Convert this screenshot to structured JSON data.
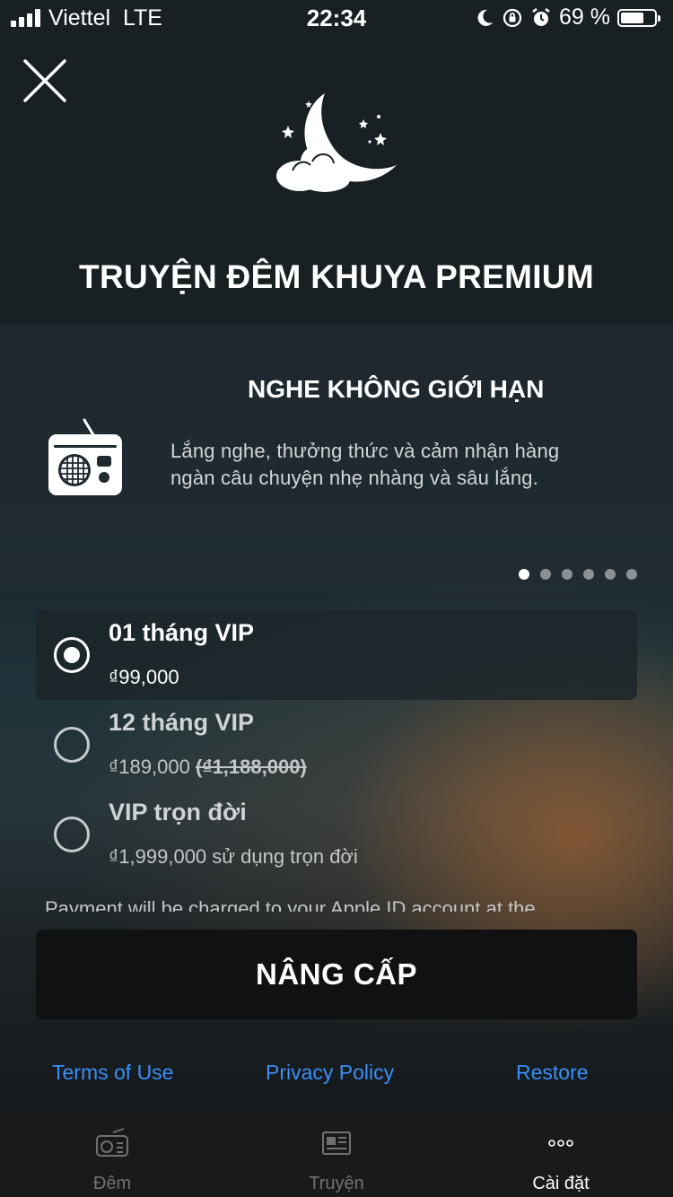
{
  "status_bar": {
    "carrier": "Viettel",
    "network": "LTE",
    "time": "22:34",
    "battery": "69 %",
    "battery_level": 0.69
  },
  "header": {
    "title": "TRUYỆN ĐÊM KHUYA PREMIUM"
  },
  "feature": {
    "title": "NGHE KHÔNG GIỚI HẠN",
    "description_line1": "Lắng nghe, thưởng thức và cảm nhận hàng",
    "description_line2": "ngàn câu chuyện nhẹ nhàng và sâu lắng.",
    "page_count": 6,
    "active_page": 1
  },
  "plans": [
    {
      "name": "01 tháng VIP",
      "price": "₫99,000",
      "original_price": "",
      "selected": true
    },
    {
      "name": "12 tháng VIP",
      "price": "₫189,000",
      "original_price": "(₫1,188,000)",
      "selected": false
    },
    {
      "name": "VIP trọn đời",
      "price": "₫1,999,000 sử dụng trọn đời",
      "original_price": "",
      "selected": false
    }
  ],
  "terms_preview": "Payment will be charged to your Apple ID account at the",
  "upgrade_button": "NÂNG CẤP",
  "links": {
    "terms": "Terms of Use",
    "privacy": "Privacy Policy",
    "restore": "Restore"
  },
  "tabbar": {
    "tabs": [
      {
        "label": "Đêm",
        "icon": "radio-icon",
        "active": false
      },
      {
        "label": "Truyện",
        "icon": "newspaper-icon",
        "active": false
      },
      {
        "label": "Cài đặt",
        "icon": "more-icon",
        "active": true
      }
    ]
  },
  "colors": {
    "link": "#3a8ef6",
    "tab_inactive": "#707070",
    "tab_active": "#ffffff"
  }
}
